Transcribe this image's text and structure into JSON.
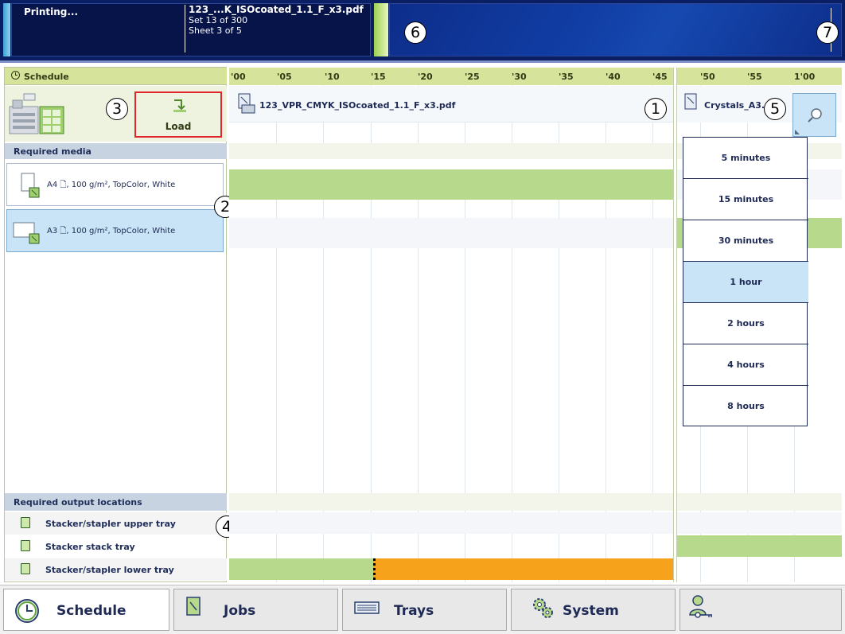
{
  "status": {
    "state": "Printing...",
    "job_name": "123_...K_ISOcoated_1.1_F_x3.pdf",
    "set_progress": "Set 13 of 300",
    "sheet_progress": "Sheet 3 of 5"
  },
  "callouts": [
    "1",
    "2",
    "3",
    "4",
    "5",
    "6",
    "7"
  ],
  "schedule": {
    "header": "Schedule",
    "load_label": "Load",
    "required_media_header": "Required media",
    "media": [
      {
        "label": "A4 🗋, 100 g/m², TopColor, White",
        "selected": false
      },
      {
        "label": "A3 🗋, 100 g/m², TopColor, White",
        "selected": true
      }
    ],
    "output_header": "Required output locations",
    "outputs": [
      "Stacker/stapler upper tray",
      "Stacker stack tray",
      "Stacker/stapler lower tray"
    ]
  },
  "timeline": {
    "ticks": [
      "'00",
      "'05",
      "'10",
      "'15",
      "'20",
      "'25",
      "'30",
      "'35",
      "'40",
      "'45",
      "'50",
      "'55",
      "1'00"
    ],
    "job1": "123_VPR_CMYK_ISOcoated_1.1_F_x3.pdf",
    "job2": "Crystals_A3.",
    "zoom_options": [
      "5 minutes",
      "15 minutes",
      "30 minutes",
      "1 hour",
      "2 hours",
      "4 hours",
      "8 hours"
    ],
    "selected_zoom": "1 hour"
  },
  "nav": {
    "schedule": "Schedule",
    "jobs": "Jobs",
    "trays": "Trays",
    "system": "System"
  },
  "colors": {
    "topbar": "#0a1f63",
    "header_green": "#d6e39b",
    "bar_green": "#b7d98c",
    "bar_orange": "#f7a21b",
    "highlight_red": "#e0262b",
    "selected_blue": "#c8e4f6"
  }
}
